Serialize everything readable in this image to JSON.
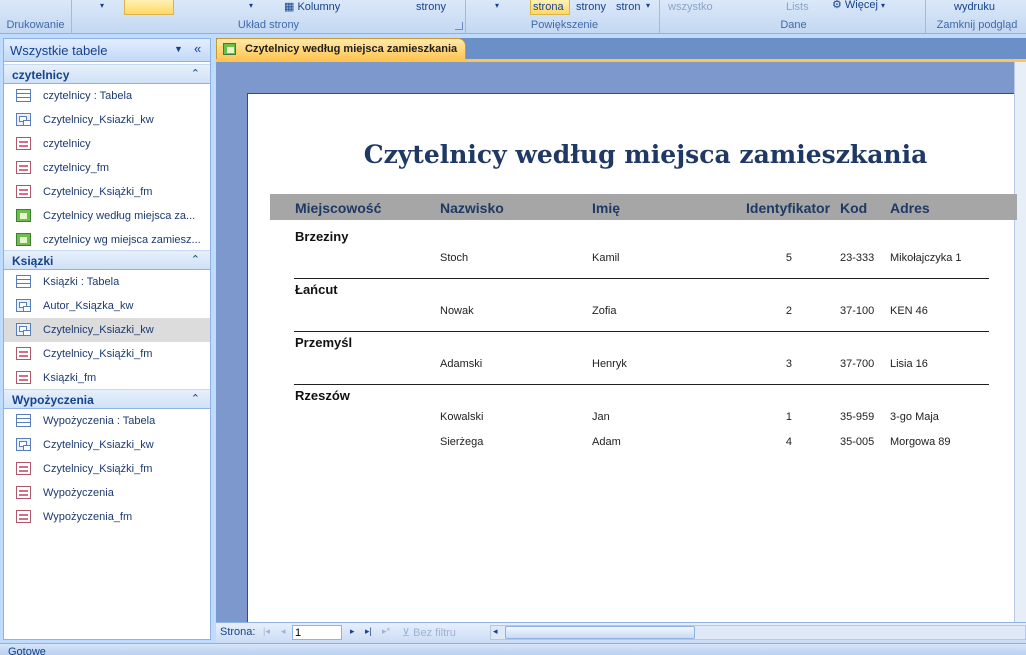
{
  "ribbon": {
    "groups": [
      {
        "label": "Drukowanie"
      },
      {
        "label": "Układ strony",
        "columns_label": "Kolumny",
        "page_label": "strony"
      },
      {
        "label": "Powiększenie",
        "one_page": "strona",
        "two_pages": "strony",
        "more_pages": "stron"
      },
      {
        "label": "Dane",
        "all_label": "wszystko",
        "lists_label": "Lists",
        "more_label": "Więcej"
      },
      {
        "label": "Zamknij podgląd",
        "close_label": "wydruku"
      }
    ]
  },
  "nav": {
    "title": "Wszystkie tabele",
    "groups": [
      {
        "title": "czytelnicy",
        "items": [
          {
            "label": "czytelnicy : Tabela",
            "type": "table"
          },
          {
            "label": "Czytelnicy_Ksiazki_kw",
            "type": "query"
          },
          {
            "label": "czytelnicy",
            "type": "form"
          },
          {
            "label": "czytelnicy_fm",
            "type": "form"
          },
          {
            "label": "Czytelnicy_Książki_fm",
            "type": "form"
          },
          {
            "label": "Czytelnicy według miejsca za...",
            "type": "report"
          },
          {
            "label": "czytelnicy wg miejsca zamiesz...",
            "type": "report"
          }
        ]
      },
      {
        "title": "Ksiązki",
        "items": [
          {
            "label": "Ksiązki : Tabela",
            "type": "table"
          },
          {
            "label": "Autor_Ksiązka_kw",
            "type": "query"
          },
          {
            "label": "Czytelnicy_Ksiazki_kw",
            "type": "query",
            "selected": true
          },
          {
            "label": "Czytelnicy_Książki_fm",
            "type": "form"
          },
          {
            "label": "Ksiązki_fm",
            "type": "form"
          }
        ]
      },
      {
        "title": "Wypożyczenia",
        "items": [
          {
            "label": "Wypożyczenia : Tabela",
            "type": "table"
          },
          {
            "label": "Czytelnicy_Ksiazki_kw",
            "type": "query"
          },
          {
            "label": "Czytelnicy_Książki_fm",
            "type": "form"
          },
          {
            "label": "Wypożyczenia",
            "type": "form"
          },
          {
            "label": "Wypożyczenia_fm",
            "type": "form"
          }
        ]
      }
    ]
  },
  "tab": {
    "label": "Czytelnicy według miejsca zamieszkania"
  },
  "report": {
    "title": "Czytelnicy według miejsca zamieszkania",
    "columns": {
      "city": "Miejscowość",
      "surname": "Nazwisko",
      "name": "Imię",
      "id": "Identyfikator",
      "code": "Kod",
      "address": "Adres"
    },
    "groups": [
      {
        "city": "Brzeziny",
        "rows": [
          {
            "surname": "Stoch",
            "name": "Kamil",
            "id": "5",
            "code": "23-333",
            "address": "Mikołajczyka 1"
          }
        ]
      },
      {
        "city": "Łańcut",
        "rows": [
          {
            "surname": "Nowak",
            "name": "Zofia",
            "id": "2",
            "code": "37-100",
            "address": "KEN 46"
          }
        ]
      },
      {
        "city": "Przemyśl",
        "rows": [
          {
            "surname": "Adamski",
            "name": "Henryk",
            "id": "3",
            "code": "37-700",
            "address": "Lisia 16"
          }
        ]
      },
      {
        "city": "Rzeszów",
        "rows": [
          {
            "surname": "Kowalski",
            "name": "Jan",
            "id": "1",
            "code": "35-959",
            "address": "3-go Maja"
          },
          {
            "surname": "Sierżega",
            "name": "Adam",
            "id": "4",
            "code": "35-005",
            "address": "Morgowa 89"
          }
        ]
      }
    ]
  },
  "navbar": {
    "page_label": "Strona:",
    "page_value": "1",
    "first": "|◂",
    "prev": "◂",
    "next": "▸",
    "last": "▸|",
    "new": "▸*",
    "filter_label": "Bez filtru"
  },
  "status": {
    "text": "Gotowe"
  }
}
